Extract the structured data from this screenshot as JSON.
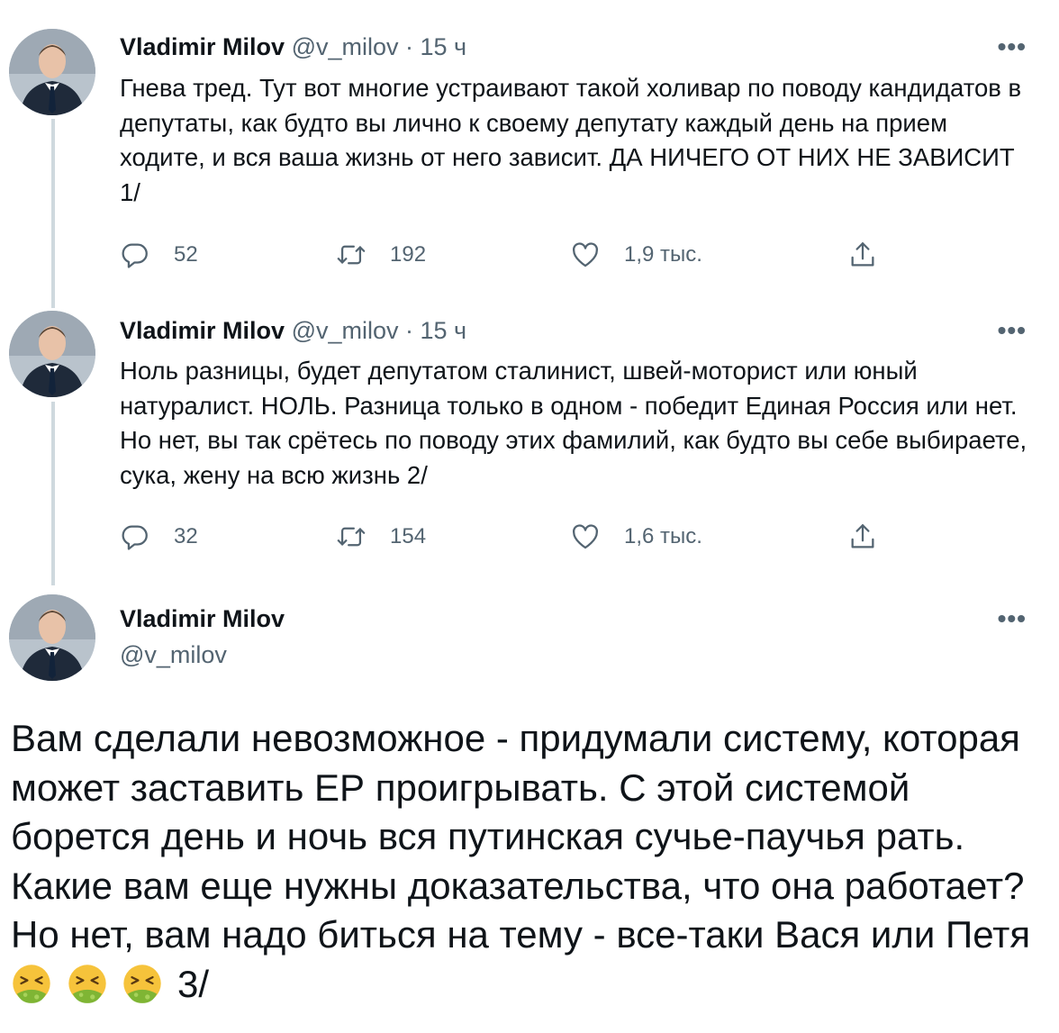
{
  "thread": {
    "tweets": [
      {
        "author_name": "Vladimir Milov",
        "author_handle": "@v_milov",
        "time": "· 15 ч",
        "text": "Гнева тред. Тут вот многие устраивают такой холивар по поводу кандидатов в депутаты, как будто вы лично к своему депутату каждый день на прием ходите, и вся ваша жизнь от него зависит. ДА НИЧЕГО ОТ НИХ НЕ ЗАВИСИТ 1/",
        "replies": "52",
        "retweets": "192",
        "likes": "1,9 тыс."
      },
      {
        "author_name": "Vladimir Milov",
        "author_handle": "@v_milov",
        "time": "· 15 ч",
        "text": "Ноль разницы, будет депутатом сталинист, швей-моторист или юный натуралист. НОЛЬ. Разница только в одном - победит Единая Россия или нет. Но нет, вы так срётесь по поводу этих фамилий, как будто вы себе выбираете, сука, жену на всю жизнь 2/",
        "replies": "32",
        "retweets": "154",
        "likes": "1,6 тыс."
      }
    ],
    "main_tweet": {
      "author_name": "Vladimir Milov",
      "author_handle": "@v_milov",
      "text": "Вам сделали невозможное - придумали систему, которая может заставить ЕР проигрывать. С этой системой борется день и ночь вся путинская сучье-паучья рать. Какие вам еще нужны доказательства, что она работает? Но нет, вам надо биться на тему - все-таки Вася или Петя",
      "emojis": [
        "nauseated-face-emoji",
        "nauseated-face-emoji",
        "nauseated-face-emoji"
      ],
      "suffix": " 3/"
    },
    "more_label": "•••",
    "icons": {
      "reply": "reply-icon",
      "retweet": "retweet-icon",
      "like": "like-icon",
      "share": "share-icon"
    },
    "colors": {
      "text": "#0f1419",
      "secondary": "#536471",
      "thread_line": "#cfd9de"
    }
  }
}
